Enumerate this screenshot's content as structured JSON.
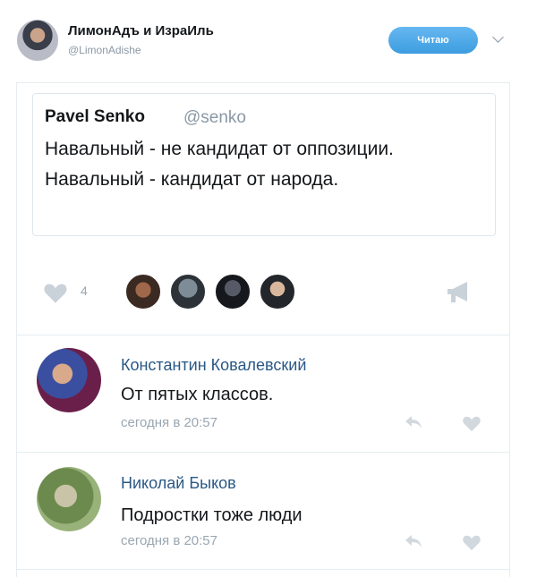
{
  "header": {
    "name": "ЛимонАдъ и ИзраИль",
    "handle": "@LimonAdishe",
    "follow_label": "Читаю"
  },
  "quote": {
    "author": "Pavel Senko",
    "handle": "@senko",
    "text": "Навальный - не кандидат от оппозиции. Навальный - кандидат от народа."
  },
  "actions": {
    "like_count": "4"
  },
  "comments": [
    {
      "author": "Константин Ковалевский",
      "text": "От пятых классов.",
      "time": "сегодня в 20:57"
    },
    {
      "author": "Николай Быков",
      "text": "Подростки тоже люди",
      "time": "сегодня в 20:57"
    }
  ],
  "colors": {
    "accent": "#3d9de0",
    "link": "#2a5885",
    "muted": "#9aa6b2"
  }
}
